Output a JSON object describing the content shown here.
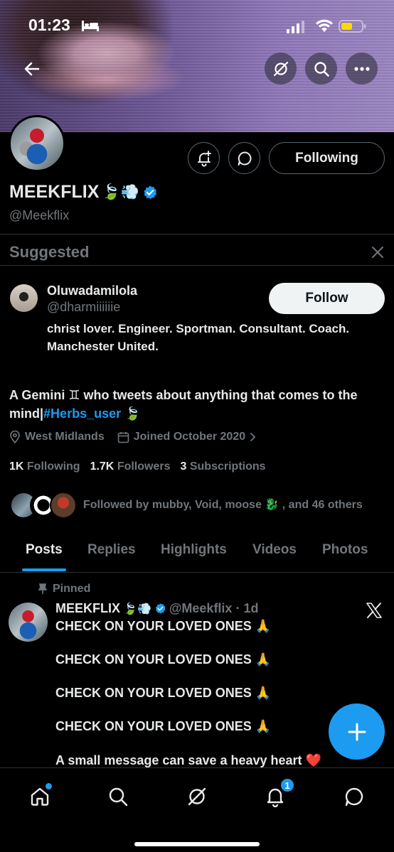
{
  "status_bar": {
    "time": "01:23"
  },
  "profile": {
    "name": "MEEKFLIX",
    "name_emoji": "🍃💨",
    "handle": "@Meekflix",
    "following_button": "Following",
    "bio_prefix": "A Gemini ♊ who tweets about anything that comes to the mind|",
    "bio_hashtag": "#Herbs_user",
    "bio_suffix": " 🍃",
    "location": "West Midlands",
    "joined": "Joined October 2020",
    "following_count": "1K",
    "following_label": "Following",
    "followers_count": "1.7K",
    "followers_label": "Followers",
    "subscriptions_count": "3",
    "subscriptions_label": "Subscriptions",
    "followed_by": "Followed by mubby, Void, moose 🐉 , and 46 others"
  },
  "suggested": {
    "title": "Suggested",
    "name": "Oluwadamilola",
    "handle": "@dharmiiiiiie",
    "bio": "christ lover. Engineer. Sportman. Consultant. Coach. Manchester United.",
    "follow_button": "Follow"
  },
  "tabs": [
    "Posts",
    "Replies",
    "Highlights",
    "Videos",
    "Photos"
  ],
  "post": {
    "pinned_label": "Pinned",
    "author": "MEEKFLIX",
    "author_emoji": "🍃💨",
    "handle_time": "@Meekflix · 1d",
    "lines": [
      "CHECK ON YOUR LOVED ONES 🙏",
      "CHECK ON YOUR LOVED ONES 🙏",
      "CHECK ON YOUR LOVED ONES 🙏",
      "CHECK ON YOUR LOVED ONES 🙏",
      "A small message can save a heavy heart ❤️"
    ]
  },
  "nav": {
    "notifications_badge": "1"
  },
  "colors": {
    "accent": "#1d9bf0",
    "background": "#000000",
    "muted": "#71767b",
    "text": "#e7e9ea"
  }
}
